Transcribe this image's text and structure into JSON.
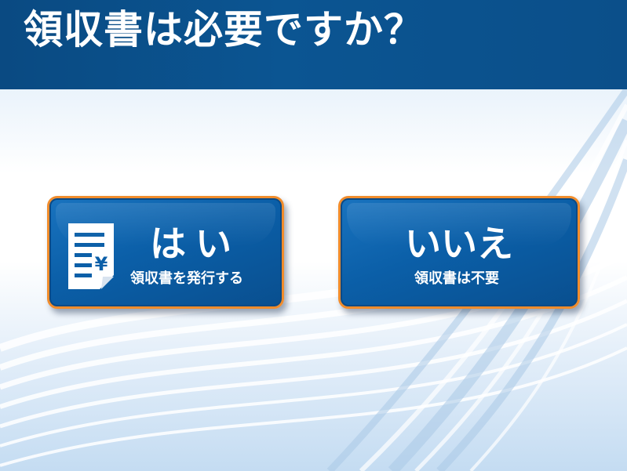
{
  "header": {
    "title": "領収書は必要ですか？"
  },
  "options": {
    "yes": {
      "label": "はい",
      "sublabel": "領収書を発行する",
      "icon": "receipt-document-icon",
      "icon_glyph": "¥"
    },
    "no": {
      "label": "いいえ",
      "sublabel": "領収書は不要"
    }
  },
  "colors": {
    "header_bg": "#0b5592",
    "button_bg": "#0b5fa8",
    "button_border": "#f08c2c",
    "text": "#ffffff"
  }
}
